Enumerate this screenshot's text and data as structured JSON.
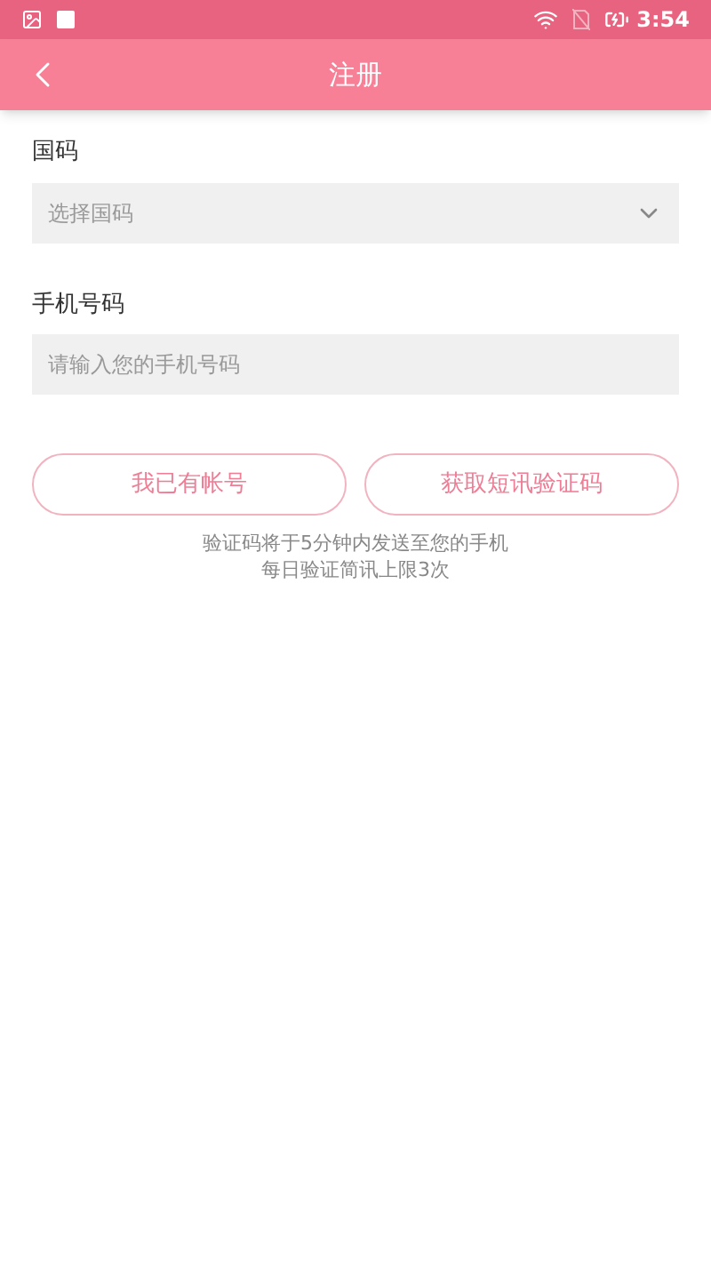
{
  "status_bar": {
    "time": "3:54"
  },
  "app_bar": {
    "title": "注册"
  },
  "country_code": {
    "label": "国码",
    "placeholder": "选择国码"
  },
  "phone": {
    "label": "手机号码",
    "placeholder": "请输入您的手机号码"
  },
  "buttons": [
    "我已有帐号",
    "获取短讯验证码"
  ],
  "notes": [
    "验证码将于5分钟内发送至您的手机",
    "每日验证简讯上限3次"
  ]
}
